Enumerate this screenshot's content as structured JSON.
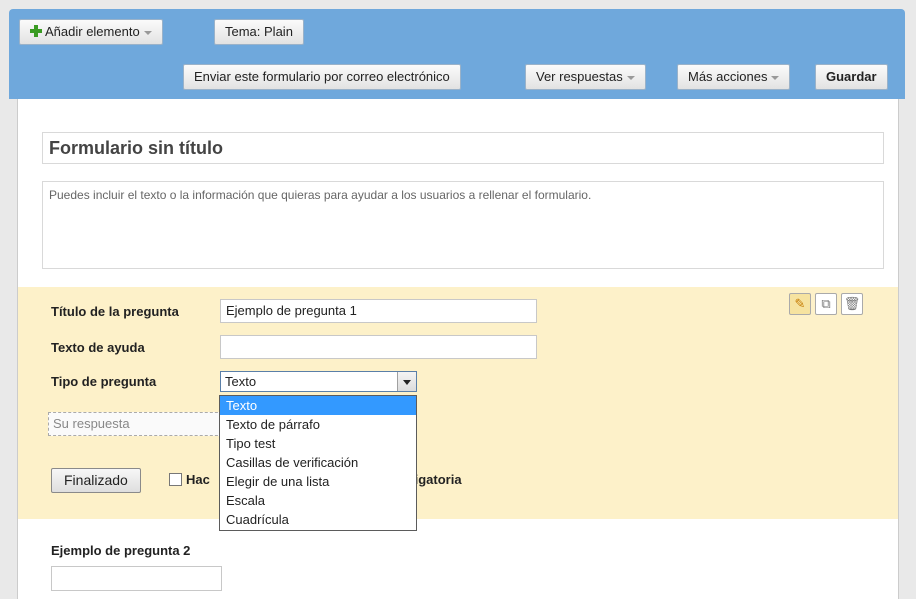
{
  "toolbar": {
    "add_item_label": "Añadir elemento",
    "theme_label": "Tema:  Plain",
    "send_email_label": "Enviar este formulario por correo electrónico",
    "view_responses_label": "Ver respuestas",
    "more_actions_label": "Más acciones",
    "save_label": "Guardar"
  },
  "form": {
    "title": "Formulario sin título",
    "description": "Puedes incluir el texto o la información que quieras para ayudar a los usuarios a rellenar el formulario."
  },
  "question_editor": {
    "title_label": "Título de la pregunta",
    "title_value": "Ejemplo de pregunta 1",
    "help_label": "Texto de ayuda",
    "help_value": "",
    "type_label": "Tipo de pregunta",
    "type_value": "Texto",
    "preview_placeholder": "Su respuesta",
    "done_label": "Finalizado",
    "required_label_start": "Hac",
    "required_label_end": "ligatoria",
    "type_options": [
      "Texto",
      "Texto de párrafo",
      "Tipo test",
      "Casillas de verificación",
      "Elegir de una lista",
      "Escala",
      "Cuadrícula"
    ]
  },
  "question2": {
    "title": "Ejemplo de pregunta 2"
  },
  "icons": [
    "plus-icon",
    "pencil-icon",
    "duplicate-icon",
    "trash-icon",
    "dropdown-arrow-icon"
  ],
  "colors": {
    "toolbar_bg": "#6fa8dc",
    "edit_panel_bg": "#fdf1c9",
    "selected_option_bg": "#3399ff",
    "plus_green": "#3a9b22"
  }
}
